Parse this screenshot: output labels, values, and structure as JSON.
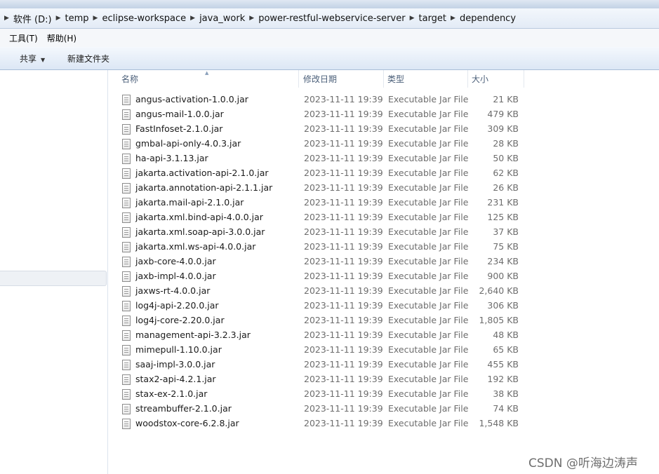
{
  "breadcrumb": {
    "items": [
      "软件 (D:)",
      "temp",
      "eclipse-workspace",
      "java_work",
      "power-restful-webservice-server",
      "target",
      "dependency"
    ]
  },
  "menubar": {
    "tools": "工具(T)",
    "help": "帮助(H)"
  },
  "commandbar": {
    "share": "共享",
    "new_folder": "新建文件夹"
  },
  "columns": {
    "name": "名称",
    "modified": "修改日期",
    "type": "类型",
    "size": "大小"
  },
  "files": [
    {
      "name": "angus-activation-1.0.0.jar",
      "date": "2023-11-11 19:39",
      "type": "Executable Jar File",
      "size": "21 KB"
    },
    {
      "name": "angus-mail-1.0.0.jar",
      "date": "2023-11-11 19:39",
      "type": "Executable Jar File",
      "size": "479 KB"
    },
    {
      "name": "FastInfoset-2.1.0.jar",
      "date": "2023-11-11 19:39",
      "type": "Executable Jar File",
      "size": "309 KB"
    },
    {
      "name": "gmbal-api-only-4.0.3.jar",
      "date": "2023-11-11 19:39",
      "type": "Executable Jar File",
      "size": "28 KB"
    },
    {
      "name": "ha-api-3.1.13.jar",
      "date": "2023-11-11 19:39",
      "type": "Executable Jar File",
      "size": "50 KB"
    },
    {
      "name": "jakarta.activation-api-2.1.0.jar",
      "date": "2023-11-11 19:39",
      "type": "Executable Jar File",
      "size": "62 KB"
    },
    {
      "name": "jakarta.annotation-api-2.1.1.jar",
      "date": "2023-11-11 19:39",
      "type": "Executable Jar File",
      "size": "26 KB"
    },
    {
      "name": "jakarta.mail-api-2.1.0.jar",
      "date": "2023-11-11 19:39",
      "type": "Executable Jar File",
      "size": "231 KB"
    },
    {
      "name": "jakarta.xml.bind-api-4.0.0.jar",
      "date": "2023-11-11 19:39",
      "type": "Executable Jar File",
      "size": "125 KB"
    },
    {
      "name": "jakarta.xml.soap-api-3.0.0.jar",
      "date": "2023-11-11 19:39",
      "type": "Executable Jar File",
      "size": "37 KB"
    },
    {
      "name": "jakarta.xml.ws-api-4.0.0.jar",
      "date": "2023-11-11 19:39",
      "type": "Executable Jar File",
      "size": "75 KB"
    },
    {
      "name": "jaxb-core-4.0.0.jar",
      "date": "2023-11-11 19:39",
      "type": "Executable Jar File",
      "size": "234 KB"
    },
    {
      "name": "jaxb-impl-4.0.0.jar",
      "date": "2023-11-11 19:39",
      "type": "Executable Jar File",
      "size": "900 KB"
    },
    {
      "name": "jaxws-rt-4.0.0.jar",
      "date": "2023-11-11 19:39",
      "type": "Executable Jar File",
      "size": "2,640 KB"
    },
    {
      "name": "log4j-api-2.20.0.jar",
      "date": "2023-11-11 19:39",
      "type": "Executable Jar File",
      "size": "306 KB"
    },
    {
      "name": "log4j-core-2.20.0.jar",
      "date": "2023-11-11 19:39",
      "type": "Executable Jar File",
      "size": "1,805 KB"
    },
    {
      "name": "management-api-3.2.3.jar",
      "date": "2023-11-11 19:39",
      "type": "Executable Jar File",
      "size": "48 KB"
    },
    {
      "name": "mimepull-1.10.0.jar",
      "date": "2023-11-11 19:39",
      "type": "Executable Jar File",
      "size": "65 KB"
    },
    {
      "name": "saaj-impl-3.0.0.jar",
      "date": "2023-11-11 19:39",
      "type": "Executable Jar File",
      "size": "455 KB"
    },
    {
      "name": "stax2-api-4.2.1.jar",
      "date": "2023-11-11 19:39",
      "type": "Executable Jar File",
      "size": "192 KB"
    },
    {
      "name": "stax-ex-2.1.0.jar",
      "date": "2023-11-11 19:39",
      "type": "Executable Jar File",
      "size": "38 KB"
    },
    {
      "name": "streambuffer-2.1.0.jar",
      "date": "2023-11-11 19:39",
      "type": "Executable Jar File",
      "size": "74 KB"
    },
    {
      "name": "woodstox-core-6.2.8.jar",
      "date": "2023-11-11 19:39",
      "type": "Executable Jar File",
      "size": "1,548 KB"
    }
  ],
  "watermark": "CSDN @听海边涛声",
  "icons": {
    "file": "jar-file-icon",
    "crumb_separator": "chevron-right-icon",
    "dropdown": "caret-down-icon",
    "sort": "sort-ascending-icon"
  },
  "colors": {
    "header_text": "#4c607a",
    "meta_text": "#6d6d6d",
    "commandbar_bg": "#dce7f5"
  }
}
